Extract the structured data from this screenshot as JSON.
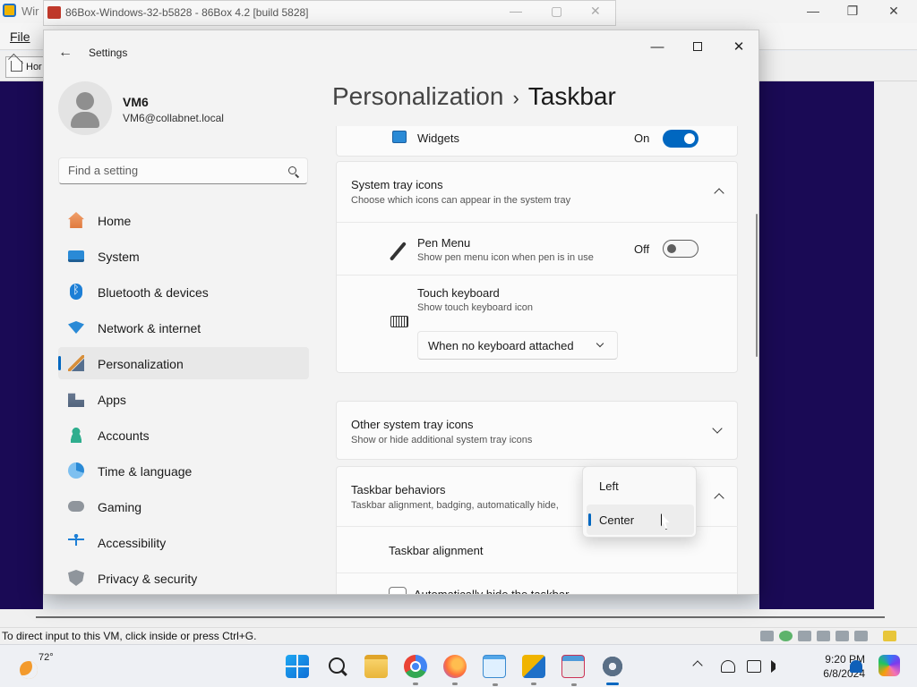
{
  "host": {
    "title": "Wir",
    "menu_file": "File",
    "home_tab": "Hor",
    "status_text": "To direct input to this VM, click inside or press Ctrl+G."
  },
  "bg_window": {
    "title": "86Box-Windows-32-b5828 - 86Box 4.2 [build 5828]"
  },
  "settings": {
    "window_title": "Settings",
    "profile": {
      "name": "VM6",
      "email": "VM6@collabnet.local"
    },
    "search": {
      "placeholder": "Find a setting"
    },
    "nav": [
      {
        "label": "Home",
        "icon": "home-icon"
      },
      {
        "label": "System",
        "icon": "monitor-icon"
      },
      {
        "label": "Bluetooth & devices",
        "icon": "bluetooth-icon"
      },
      {
        "label": "Network & internet",
        "icon": "wifi-icon"
      },
      {
        "label": "Personalization",
        "icon": "brush-icon",
        "selected": true
      },
      {
        "label": "Apps",
        "icon": "apps-icon"
      },
      {
        "label": "Accounts",
        "icon": "person-icon"
      },
      {
        "label": "Time & language",
        "icon": "globe-clock-icon"
      },
      {
        "label": "Gaming",
        "icon": "controller-icon"
      },
      {
        "label": "Accessibility",
        "icon": "accessibility-icon"
      },
      {
        "label": "Privacy & security",
        "icon": "shield-icon"
      }
    ],
    "breadcrumb": {
      "parent": "Personalization",
      "separator": "›",
      "current": "Taskbar"
    },
    "widgets": {
      "label": "Widgets",
      "state": "On"
    },
    "system_tray": {
      "title": "System tray icons",
      "subtitle": "Choose which icons can appear in the system tray",
      "pen_menu": {
        "label": "Pen Menu",
        "desc": "Show pen menu icon when pen is in use",
        "state": "Off"
      },
      "touch_keyboard": {
        "label": "Touch keyboard",
        "desc": "Show touch keyboard icon",
        "value": "When no keyboard attached"
      }
    },
    "other_tray": {
      "title": "Other system tray icons",
      "subtitle": "Show or hide additional system tray icons"
    },
    "behaviors": {
      "title": "Taskbar behaviors",
      "subtitle": "Taskbar alignment, badging, automatically hide,",
      "alignment_label": "Taskbar alignment",
      "alignment_options": [
        "Left",
        "Center"
      ],
      "alignment_selected": "Center",
      "autohide_label": "Automatically hide the taskbar"
    }
  },
  "taskbar": {
    "weather_temp": "72°",
    "time": "9:20 PM",
    "date": "6/8/2024"
  },
  "colors": {
    "accent": "#0067c0",
    "vm_background": "#1a0a55"
  }
}
